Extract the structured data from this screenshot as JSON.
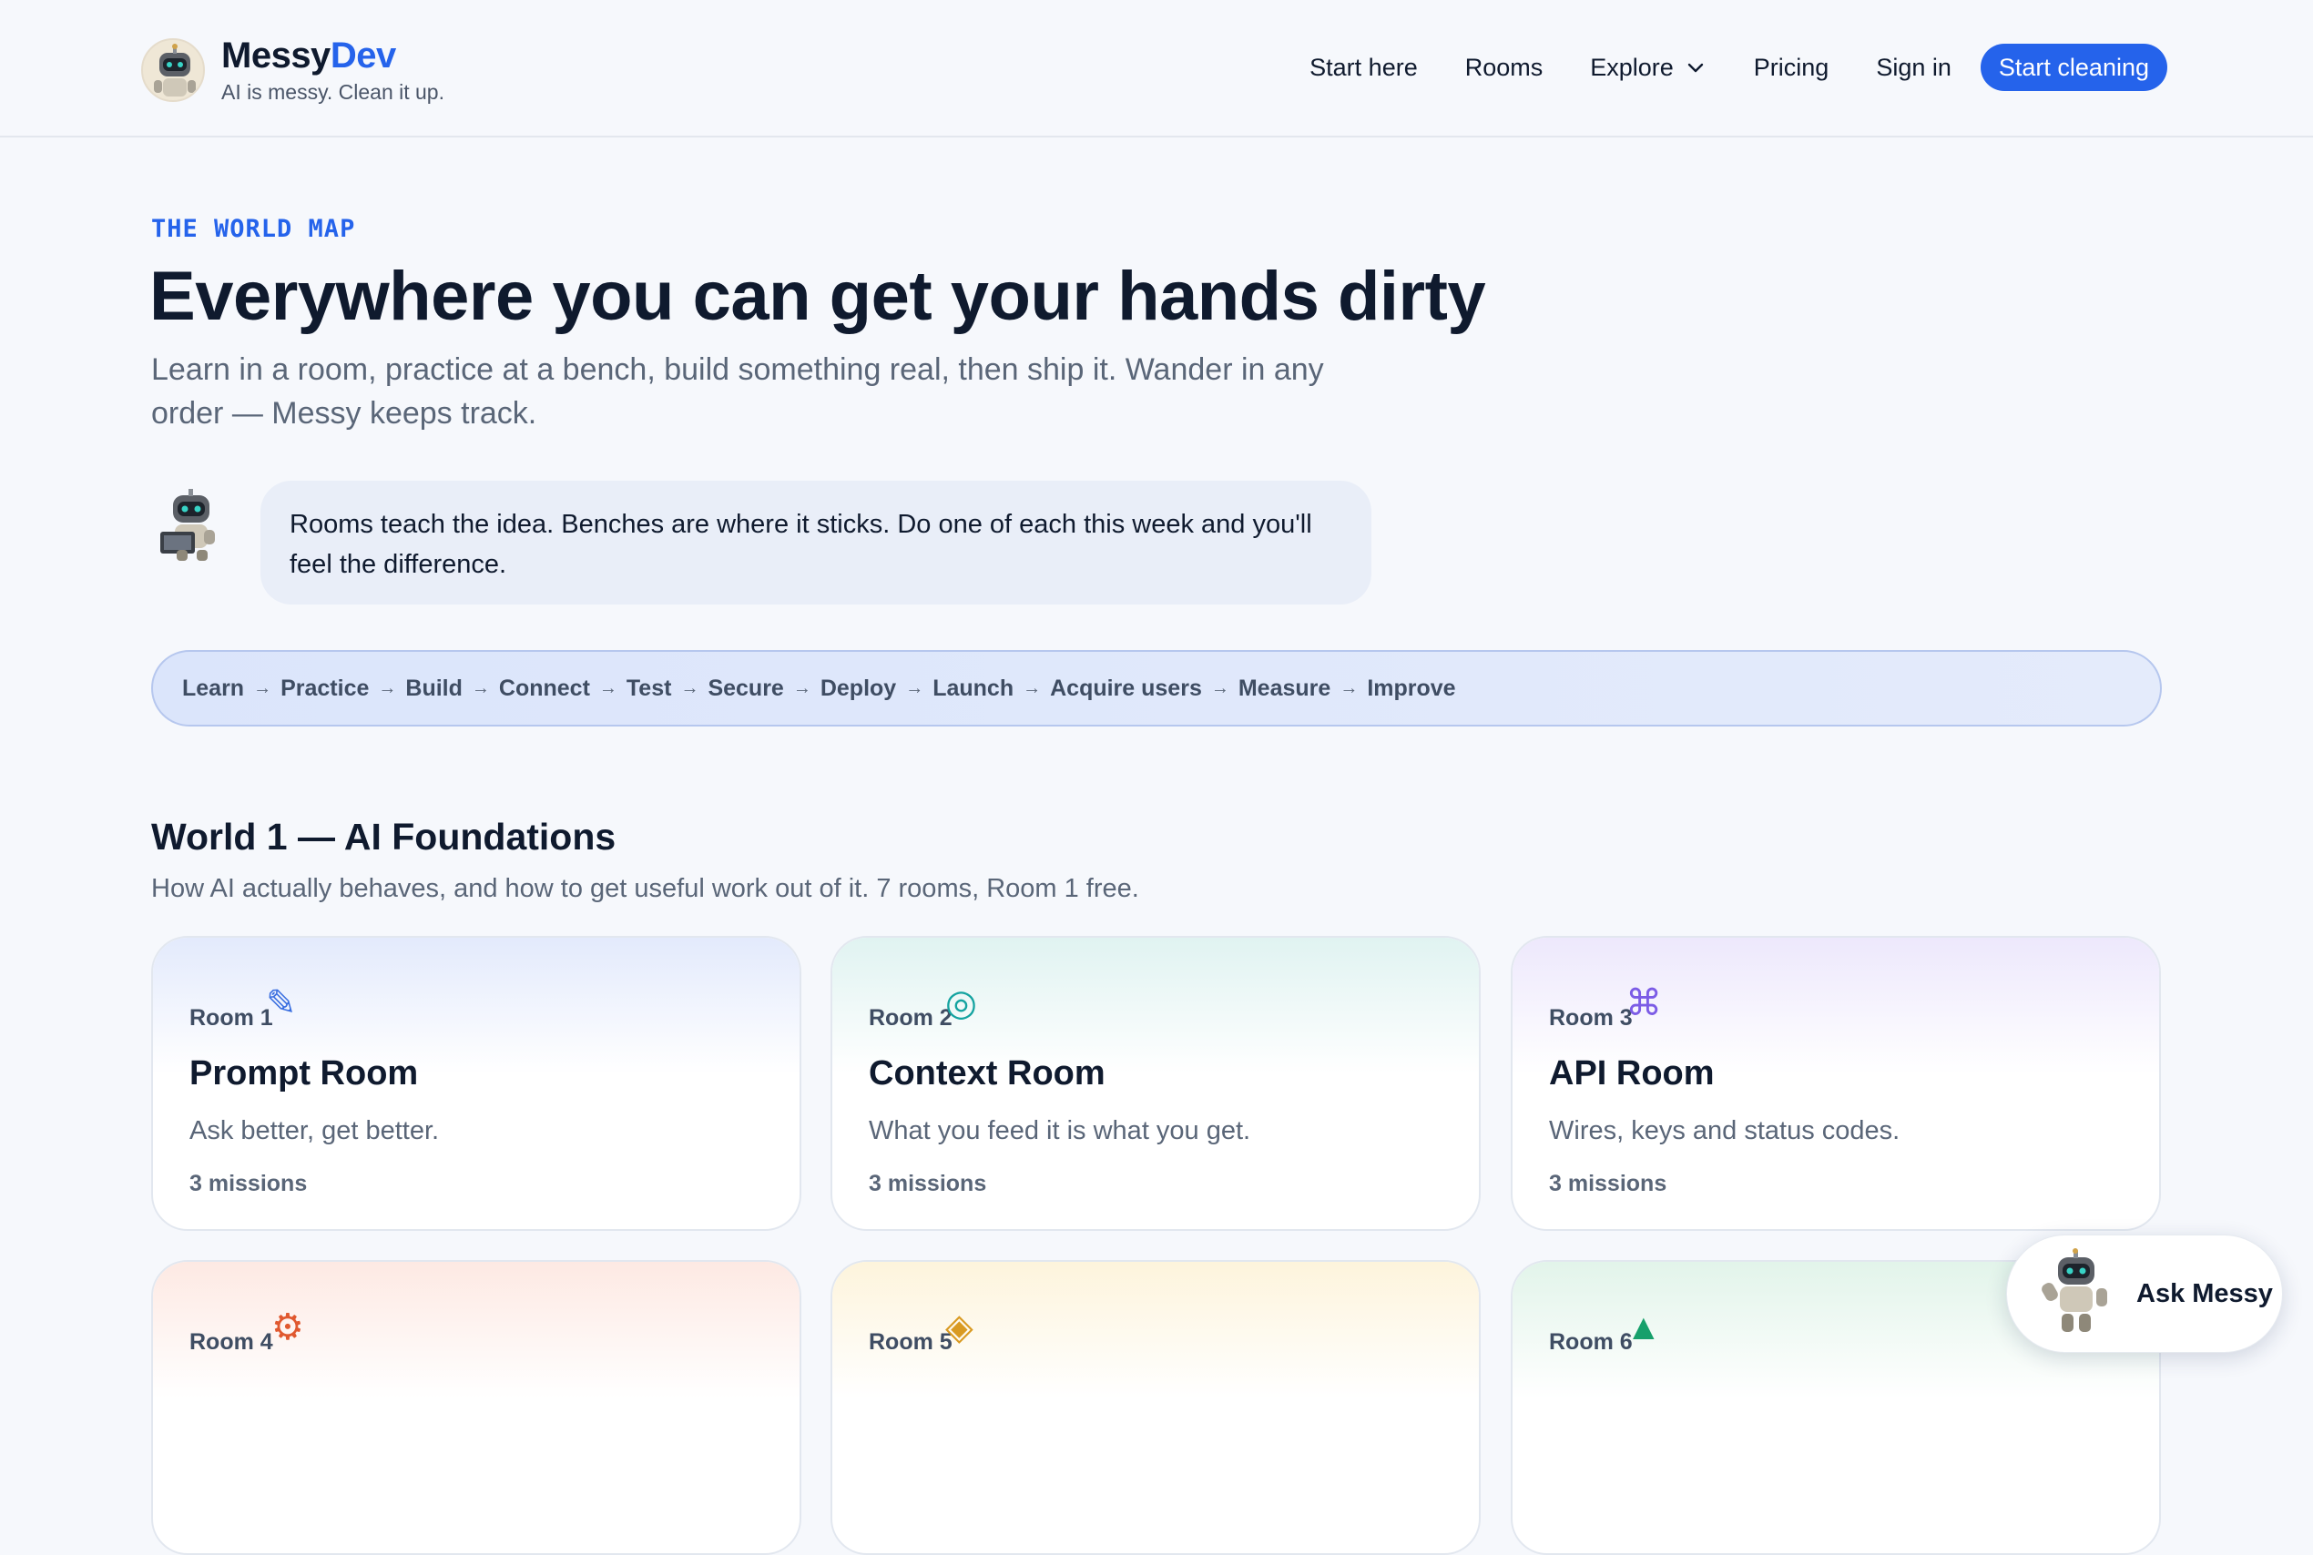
{
  "header": {
    "brand_main": "Messy",
    "brand_accent": "Dev",
    "tagline": "AI is messy. Clean it up.",
    "nav": {
      "start_here": "Start here",
      "rooms": "Rooms",
      "explore": "Explore",
      "pricing": "Pricing",
      "sign_in": "Sign in",
      "cta": "Start cleaning"
    }
  },
  "hero": {
    "eyebrow": "THE WORLD MAP",
    "title": "Everywhere you can get your hands dirty",
    "subtitle": "Learn in a room, practice at a bench, build something real, then ship it. Wander in any order — Messy keeps track.",
    "messy_tip": "Rooms teach the idea. Benches are where it sticks. Do one of each this week and you'll feel the difference."
  },
  "path": {
    "steps": [
      "Learn",
      "Practice",
      "Build",
      "Connect",
      "Test",
      "Secure",
      "Deploy",
      "Launch",
      "Acquire users",
      "Measure",
      "Improve"
    ],
    "arrow": "→"
  },
  "world": {
    "title": "World 1 — AI Foundations",
    "subtitle": "How AI actually behaves, and how to get useful work out of it. 7 rooms, Room 1 free.",
    "rooms": [
      {
        "label": "Room 1",
        "icon": "✎",
        "icon_name": "pencil-icon",
        "title": "Prompt Room",
        "desc": "Ask better, get better.",
        "meta": "3 missions",
        "accent": "#3b6fe0",
        "grad": "#e3eafc"
      },
      {
        "label": "Room 2",
        "icon": "◎",
        "icon_name": "target-icon",
        "title": "Context Room",
        "desc": "What you feed it is what you get.",
        "meta": "3 missions",
        "accent": "#14a3a0",
        "grad": "#e0f3f1"
      },
      {
        "label": "Room 3",
        "icon": "⌘",
        "icon_name": "command-icon",
        "title": "API Room",
        "desc": "Wires, keys and status codes.",
        "meta": "3 missions",
        "accent": "#7c5ce6",
        "grad": "#ede8fc"
      },
      {
        "label": "Room 4",
        "icon": "⚙",
        "icon_name": "gear-icon",
        "accent": "#e0582f",
        "grad": "#fde9e3"
      },
      {
        "label": "Room 5",
        "icon": "◈",
        "icon_name": "diamond-icon",
        "accent": "#d99a22",
        "grad": "#fdf4dc"
      },
      {
        "label": "Room 6",
        "icon": "▲",
        "icon_name": "triangle-icon",
        "accent": "#17a06b",
        "grad": "#e2f4ea"
      }
    ]
  },
  "ask": {
    "label": "Ask Messy"
  }
}
